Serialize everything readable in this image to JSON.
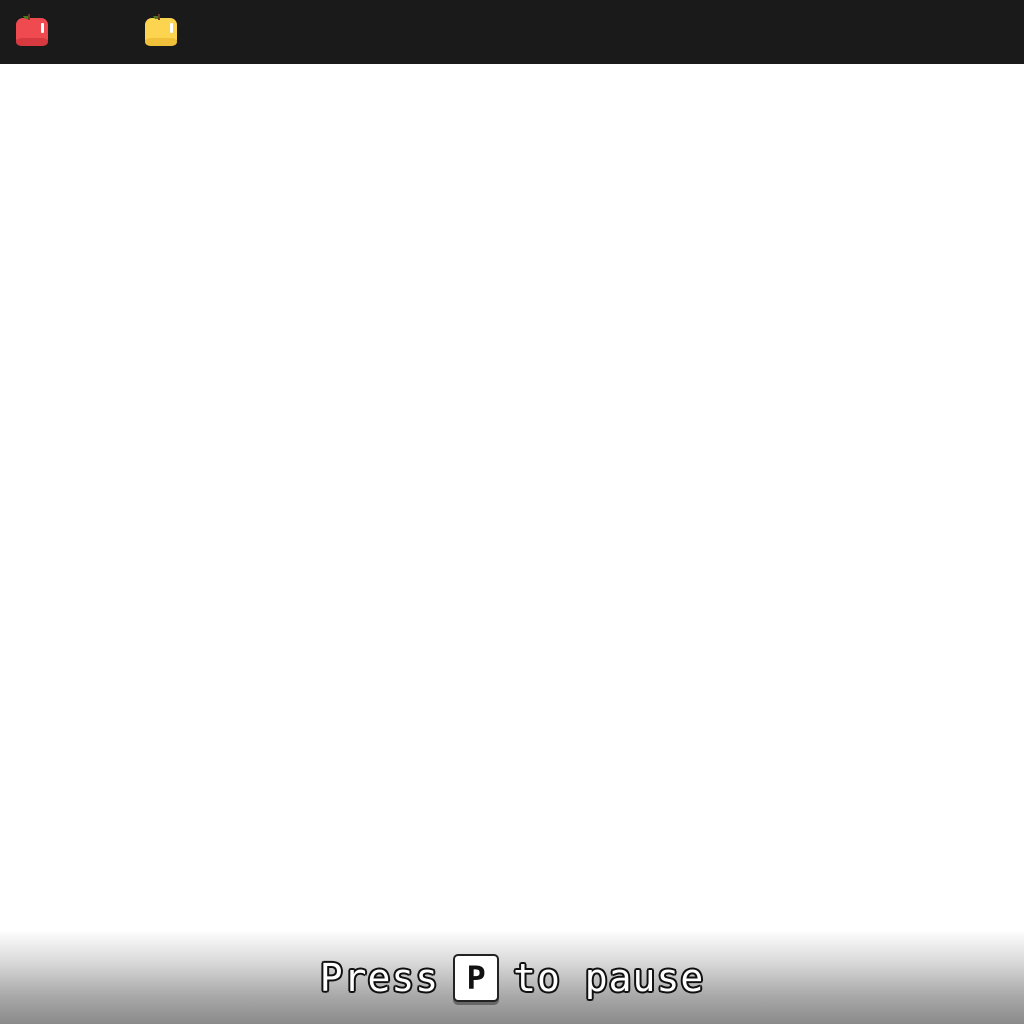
{
  "top_bar": {
    "items": [
      {
        "icon": "red-apple-icon",
        "color": "#ef4a4f"
      },
      {
        "icon": "yellow-apple-icon",
        "color": "#fcd44f"
      }
    ]
  },
  "hint": {
    "prefix": "Press",
    "key": "P",
    "suffix": "to pause"
  },
  "colors": {
    "top_bar_bg": "#1a1a1a",
    "play_area_bg": "#ffffff",
    "red_apple": "#ef4a4f",
    "yellow_apple": "#fcd44f",
    "leaf": "#4a7a1e",
    "stem": "#6b3a1f"
  }
}
